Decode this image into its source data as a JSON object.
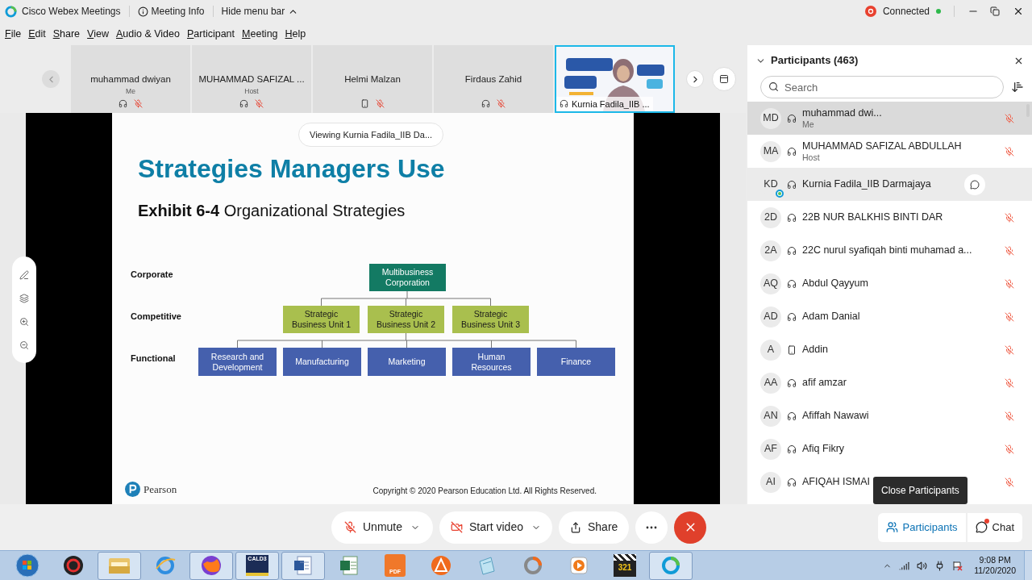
{
  "title_bar": {
    "app_name": "Cisco Webex Meetings",
    "meeting_info": "Meeting Info",
    "hide_menu_bar": "Hide menu bar",
    "status": "Connected",
    "connected": true
  },
  "menu_bar": [
    "File",
    "Edit",
    "Share",
    "View",
    "Audio & Video",
    "Participant",
    "Meeting",
    "Help"
  ],
  "video_strip": [
    {
      "kind": "avatar",
      "name": "muhammad dwiyan",
      "role": "Me",
      "phone": false,
      "muted": true,
      "selected": false
    },
    {
      "kind": "avatar",
      "name": "MUHAMMAD SAFIZAL ...",
      "role": "Host",
      "phone": false,
      "muted": true,
      "selected": false
    },
    {
      "kind": "avatar",
      "name": "Helmi Malzan",
      "phone": true,
      "muted": true,
      "selected": false
    },
    {
      "kind": "avatar",
      "name": "Firdaus Zahid",
      "phone": false,
      "muted": true,
      "selected": false
    },
    {
      "kind": "video",
      "name": "Kurnia Fadila_IIB ...",
      "phone": false,
      "muted": false,
      "selected": true
    }
  ],
  "stage": {
    "viewing_banner": "Viewing Kurnia Fadila_IIB Da...",
    "slide": {
      "title": "Strategies Managers Use",
      "subtitle": "**Exhibit 6-4** Organizational Strategies",
      "levels": [
        "Corporate",
        "Competitive",
        "Functional"
      ],
      "corporate": "Multibusiness\nCorporation",
      "business_units": [
        "Strategic\nBusiness Unit 1",
        "Strategic\nBusiness Unit 2",
        "Strategic\nBusiness Unit 3"
      ],
      "functions": [
        "Research and\nDevelopment",
        "Manufacturing",
        "Marketing",
        "Human\nResources",
        "Finance"
      ],
      "publisher": "Pearson",
      "copyright": "Copyright © 2020 Pearson Education Ltd. All Rights Reserved."
    }
  },
  "participants": {
    "title": "Participants (463)",
    "search_placeholder": "Search",
    "tooltip": "Close Participants",
    "items": [
      {
        "initials": "MD",
        "name": "muhammad dwi...",
        "role": "Me",
        "phone": false,
        "muted": true,
        "selected": true,
        "hovered": false,
        "presenting": false
      },
      {
        "initials": "MA",
        "name": "MUHAMMAD SAFIZAL ABDULLAH",
        "role": "Host",
        "phone": false,
        "muted": true,
        "selected": false,
        "hovered": false,
        "presenting": false
      },
      {
        "initials": "KD",
        "name": "Kurnia Fadila_IIB Darmajaya",
        "phone": false,
        "muted": false,
        "selected": false,
        "hovered": true,
        "presenting": true
      },
      {
        "initials": "2D",
        "name": "22B NUR BALKHIS BINTI DAR",
        "phone": false,
        "muted": true,
        "selected": false,
        "hovered": false,
        "presenting": false
      },
      {
        "initials": "2A",
        "name": "22C nurul syafiqah binti muhamad a...",
        "phone": false,
        "muted": true,
        "selected": false,
        "hovered": false,
        "presenting": false
      },
      {
        "initials": "AQ",
        "name": "Abdul Qayyum",
        "phone": false,
        "muted": true,
        "selected": false,
        "hovered": false,
        "presenting": false
      },
      {
        "initials": "AD",
        "name": "Adam Danial",
        "phone": false,
        "muted": true,
        "selected": false,
        "hovered": false,
        "presenting": false
      },
      {
        "initials": "A",
        "name": "Addin",
        "phone": true,
        "muted": true,
        "selected": false,
        "hovered": false,
        "presenting": false
      },
      {
        "initials": "AA",
        "name": "afif amzar",
        "phone": false,
        "muted": true,
        "selected": false,
        "hovered": false,
        "presenting": false
      },
      {
        "initials": "AN",
        "name": "Afiffah Nawawi",
        "phone": false,
        "muted": true,
        "selected": false,
        "hovered": false,
        "presenting": false
      },
      {
        "initials": "AF",
        "name": "Afiq Fikry",
        "phone": false,
        "muted": true,
        "selected": false,
        "hovered": false,
        "presenting": false
      },
      {
        "initials": "AI",
        "name": "AFIQAH ISMAI",
        "phone": false,
        "muted": true,
        "selected": false,
        "hovered": false,
        "presenting": false
      }
    ]
  },
  "controls": [
    {
      "kind": "mic",
      "label": "Unmute",
      "dropdown": true
    },
    {
      "kind": "video",
      "label": "Start video",
      "dropdown": true
    },
    {
      "kind": "share",
      "label": "Share",
      "dropdown": false
    },
    {
      "kind": "more"
    },
    {
      "kind": "end"
    }
  ],
  "panel_tabs": [
    {
      "kind": "participants",
      "label": "Participants",
      "selected": true,
      "unread": false
    },
    {
      "kind": "chat",
      "label": "Chat",
      "selected": false,
      "unread": true
    }
  ],
  "taskbar": {
    "time": "9:08 PM",
    "date": "11/20/2020",
    "apps": [
      {
        "kind": "start",
        "running": false
      },
      {
        "kind": "emblem",
        "running": false
      },
      {
        "kind": "folder",
        "running": true
      },
      {
        "kind": "ring",
        "running": false
      },
      {
        "kind": "fox",
        "running": true
      },
      {
        "kind": "book",
        "label": "CALD3",
        "running": true
      },
      {
        "kind": "document",
        "running": true
      },
      {
        "kind": "sheet",
        "running": false
      },
      {
        "kind": "pdf",
        "label": "PDF",
        "running": false
      },
      {
        "kind": "cone",
        "running": false
      },
      {
        "kind": "notepad",
        "running": false
      },
      {
        "kind": "donut",
        "running": false
      },
      {
        "kind": "play",
        "running": false
      },
      {
        "kind": "clapper",
        "label": "321",
        "running": false
      },
      {
        "kind": "webex",
        "running": true
      }
    ]
  }
}
